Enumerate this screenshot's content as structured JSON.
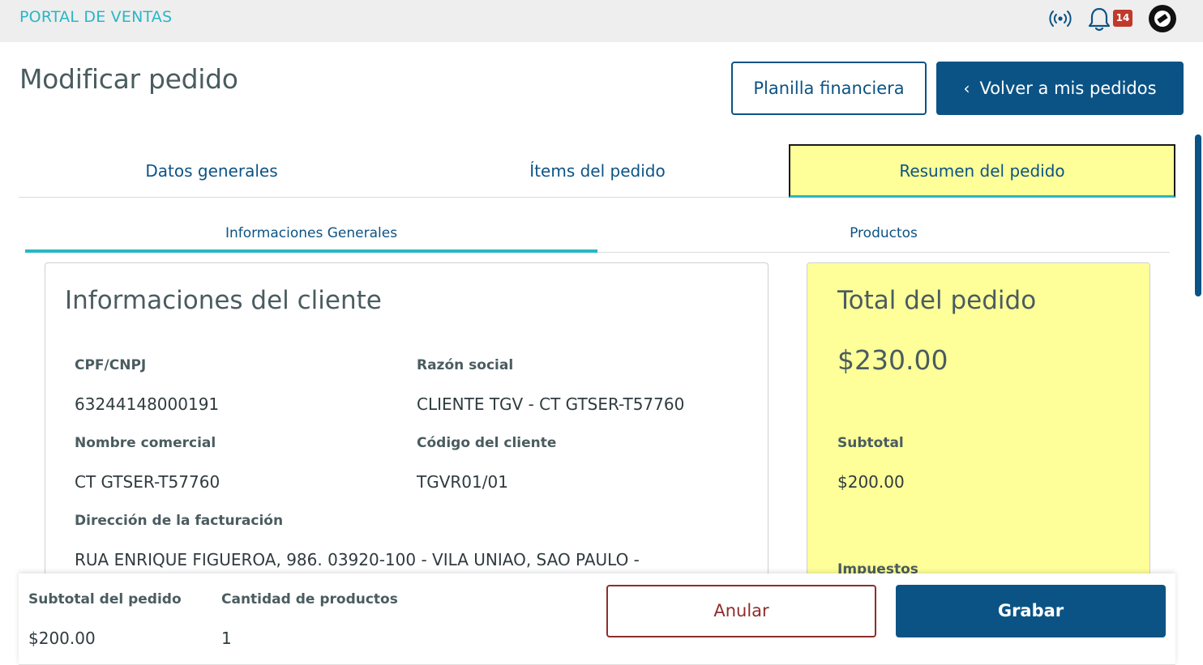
{
  "header": {
    "brand": "PORTAL DE VENTAS",
    "notification_count": "14",
    "icons": [
      "broadcast-icon",
      "bell-icon",
      "totvs-logo-icon"
    ]
  },
  "page": {
    "title": "Modificar pedido",
    "financial_button": "Planilla financiera",
    "back_button": "Volver a mis pedidos"
  },
  "tabs": [
    {
      "label": "Datos generales",
      "active": false
    },
    {
      "label": "Ítems del pedido",
      "active": false
    },
    {
      "label": "Resumen del pedido",
      "active": true
    }
  ],
  "subtabs": [
    {
      "label": "Informaciones Generales",
      "active": true
    },
    {
      "label": "Productos",
      "active": false
    }
  ],
  "client": {
    "title": "Informaciones del cliente",
    "cpf_label": "CPF/CNPJ",
    "cpf_value": "63244148000191",
    "razon_label": "Razón social",
    "razon_value": "CLIENTE TGV - CT GTSER-T57760",
    "nombre_label": "Nombre comercial",
    "nombre_value": "CT GTSER-T57760",
    "codigo_label": "Código del cliente",
    "codigo_value": "TGVR01/01",
    "direccion_label": "Dirección de la facturación",
    "direccion_value": "RUA ENRIQUE FIGUEROA, 986. 03920-100 - VILA UNIAO, SAO PAULO -"
  },
  "totals": {
    "title": "Total del pedido",
    "amount": "$230.00",
    "subtotal_label": "Subtotal",
    "subtotal_value": "$200.00",
    "impuestos_label": "Impuestos"
  },
  "footer": {
    "subtotal_label": "Subtotal del pedido",
    "subtotal_value": "$200.00",
    "cantidad_label": "Cantidad de productos",
    "cantidad_value": "1",
    "cancel_button": "Anular",
    "save_button": "Grabar"
  },
  "colors": {
    "primary": "#0c5385",
    "accent": "#29b6c5",
    "highlight": "#ffff99",
    "danger": "#8e2d2d",
    "badge": "#c0392b"
  }
}
